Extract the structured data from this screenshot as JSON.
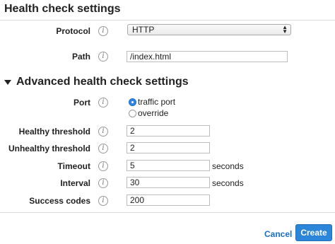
{
  "health_check": {
    "title": "Health check settings",
    "protocol": {
      "label": "Protocol",
      "value": "HTTP"
    },
    "path": {
      "label": "Path",
      "value": "/index.html"
    }
  },
  "advanced": {
    "title": "Advanced health check settings",
    "port": {
      "label": "Port",
      "options": [
        "traffic port",
        "override"
      ],
      "selected": "traffic port"
    },
    "healthy_threshold": {
      "label": "Healthy threshold",
      "value": "2"
    },
    "unhealthy_threshold": {
      "label": "Unhealthy threshold",
      "value": "2"
    },
    "timeout": {
      "label": "Timeout",
      "value": "5",
      "unit": "seconds"
    },
    "interval": {
      "label": "Interval",
      "value": "30",
      "unit": "seconds"
    },
    "success_codes": {
      "label": "Success codes",
      "value": "200"
    }
  },
  "info_glyph": "i",
  "actions": {
    "cancel": "Cancel",
    "create": "Create"
  },
  "colors": {
    "primary": "#2b86da",
    "link": "#1a6fc9",
    "radio_selected": "#2f86e6"
  }
}
